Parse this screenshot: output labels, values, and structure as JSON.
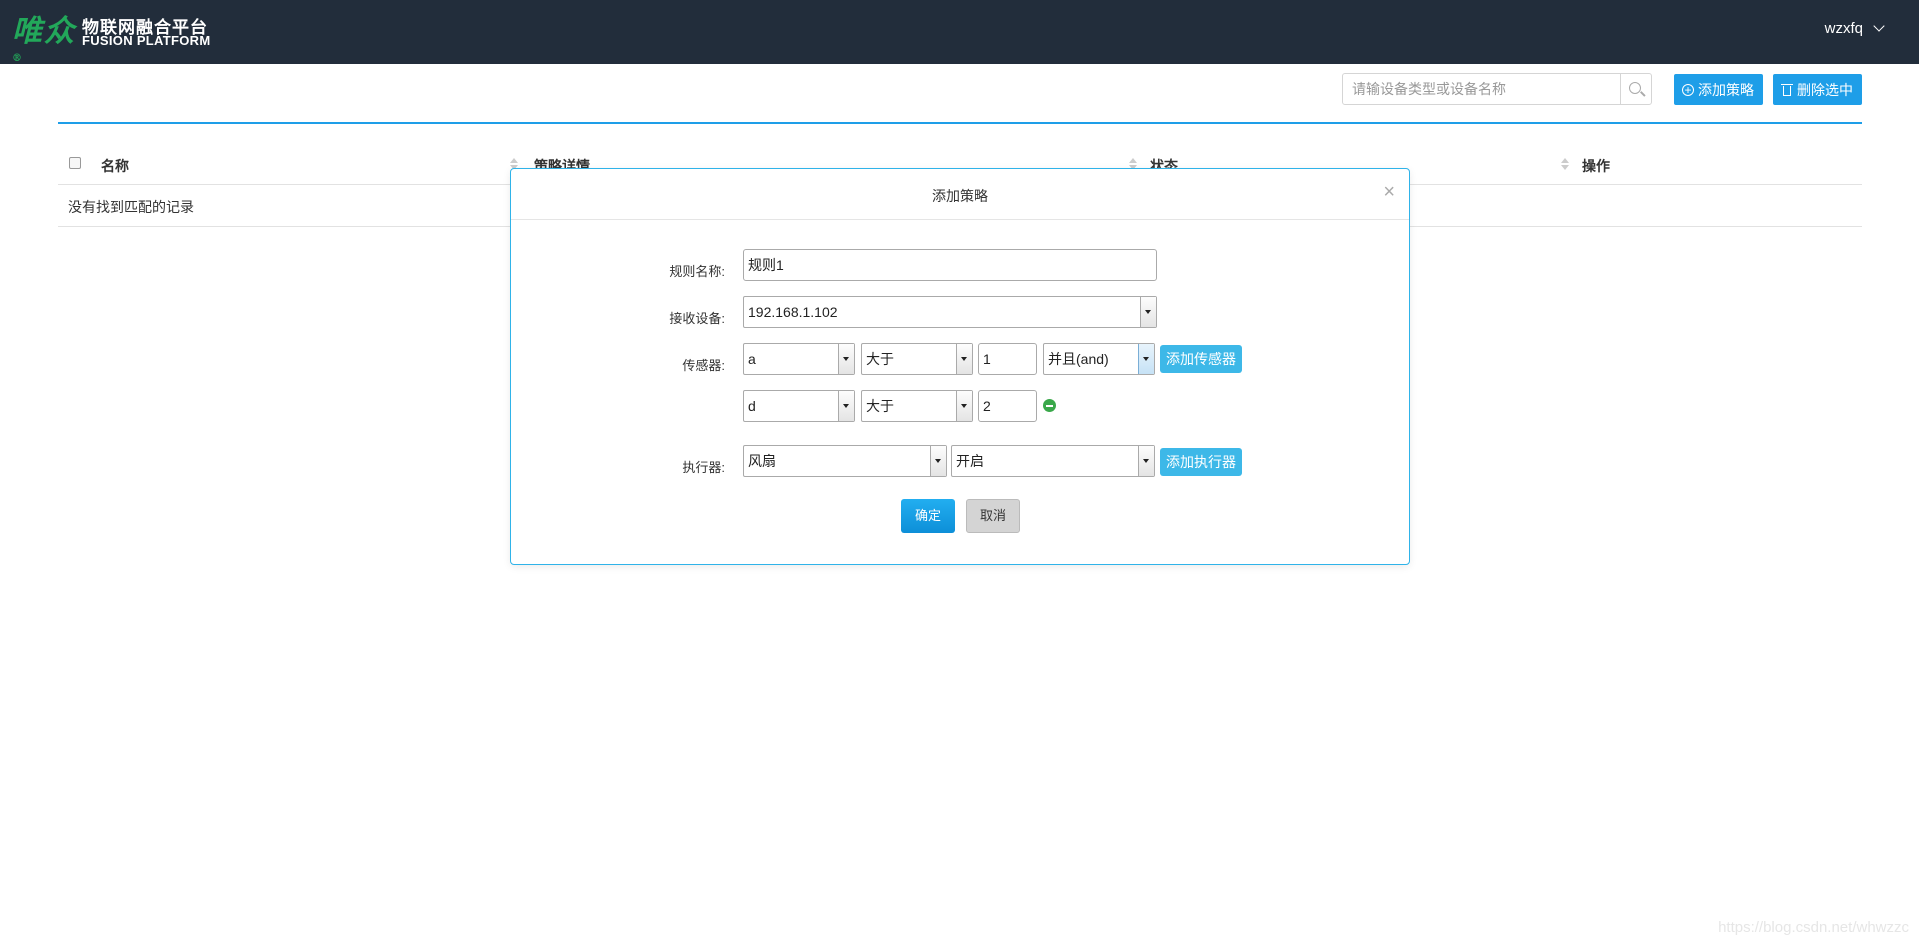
{
  "header": {
    "logo_mark": "唯众",
    "logo_reg": "®",
    "logo_cn": "物联网融合平台",
    "logo_en": "FUSION PLATFORM",
    "user_name": "wzxfq"
  },
  "toolbar": {
    "search_placeholder": "请输设备类型或设备名称",
    "add_label": "添加策略",
    "delete_label": "删除选中"
  },
  "table": {
    "columns": [
      "名称",
      "策略详情",
      "状态",
      "操作"
    ],
    "empty_text": "没有找到匹配的记录"
  },
  "modal": {
    "title": "添加策略",
    "close": "×",
    "labels": {
      "rule_name": "规则名称:",
      "receiver": "接收设备:",
      "sensor": "传感器:",
      "actuator": "执行器:"
    },
    "rule_name_value": "规则1",
    "receiver_value": "192.168.1.102",
    "sensor_rows": [
      {
        "sensor": "a",
        "operator": "大于",
        "value": "1",
        "logic": "并且(and)"
      },
      {
        "sensor": "d",
        "operator": "大于",
        "value": "2"
      }
    ],
    "add_sensor_label": "添加传感器",
    "actuator_device": "风扇",
    "actuator_state": "开启",
    "add_actuator_label": "添加执行器",
    "ok_label": "确定",
    "cancel_label": "取消"
  },
  "watermark": "https://blog.csdn.net/whwzzc"
}
